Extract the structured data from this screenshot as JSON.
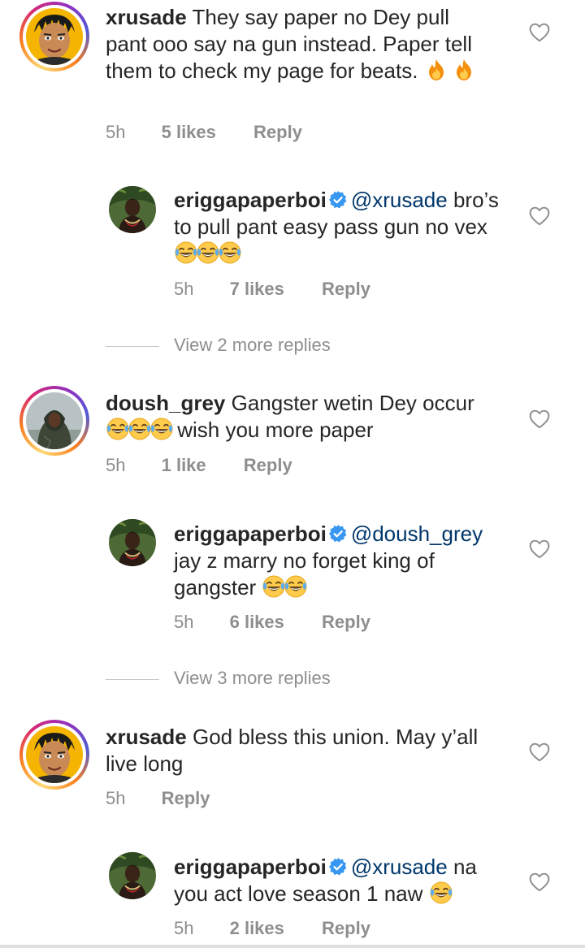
{
  "comments": [
    {
      "username": "xrusade",
      "text": "They say paper no Dey pull pant ooo say na gun instead. Paper tell them to check my page for beats.",
      "time": "5h",
      "likes": "5 likes",
      "reply_label": "Reply",
      "replies": [
        {
          "username": "eriggapaperboi",
          "mention": "@xrusade",
          "text": "bro’s to pull pant easy pass gun no vex",
          "time": "5h",
          "likes": "7 likes",
          "reply_label": "Reply"
        }
      ],
      "view_more": "View 2 more replies"
    },
    {
      "username": "doush_grey",
      "text_a": "Gangster wetin Dey occur",
      "text_b": "wish you more paper",
      "time": "5h",
      "likes": "1 like",
      "reply_label": "Reply",
      "replies": [
        {
          "username": "eriggapaperboi",
          "mention": "@doush_grey",
          "text": "jay z marry no forget king of gangster",
          "time": "5h",
          "likes": "6 likes",
          "reply_label": "Reply"
        }
      ],
      "view_more": "View 3 more replies"
    },
    {
      "username": "xrusade",
      "text": "God bless this union. May y’all live long",
      "time": "5h",
      "reply_label": "Reply",
      "replies": [
        {
          "username": "eriggapaperboi",
          "mention": "@xrusade",
          "text": "na you act love season 1 naw",
          "time": "5h",
          "likes": "2 likes",
          "reply_label": "Reply"
        }
      ]
    }
  ],
  "icons": {
    "like": "heart-outline-icon",
    "verified": "verified-badge-icon",
    "emoji_fire": "fire-emoji",
    "emoji_laugh": "tears-of-joy-emoji"
  },
  "colors": {
    "text": "#262626",
    "meta": "#8e8e8e",
    "mention": "#00376b",
    "verified": "#3897f0",
    "ring_start": "#feda75",
    "ring_end": "#962fbf"
  }
}
